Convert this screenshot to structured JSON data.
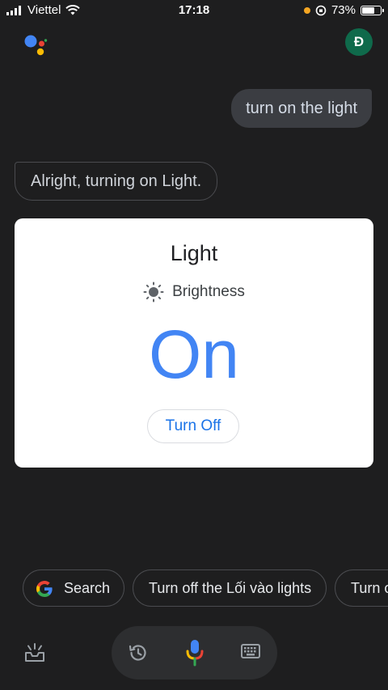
{
  "status_bar": {
    "carrier": "Viettel",
    "time": "17:18",
    "battery": "73%",
    "battery_level": 0.73
  },
  "header": {
    "avatar_initial": "Đ"
  },
  "conversation": {
    "user_query": "turn on the light",
    "assistant_reply": "Alright, turning on Light."
  },
  "device_card": {
    "device_name": "Light",
    "attribute_label": "Brightness",
    "state": "On",
    "action_button": "Turn Off"
  },
  "suggestions": [
    {
      "label": "Search",
      "icon": "google-g-icon"
    },
    {
      "label": "Turn off the Lối vào lights"
    },
    {
      "label": "Turn o"
    }
  ],
  "colors": {
    "accent_blue": "#4285f4",
    "button_text_blue": "#1a73e8",
    "background": "#1e1e1f",
    "avatar_green": "#0f6a4b"
  },
  "icons": {
    "bottom_left": "snapshot-inbox-icon",
    "history": "history-icon",
    "mic": "microphone-icon",
    "keyboard": "keyboard-icon"
  }
}
